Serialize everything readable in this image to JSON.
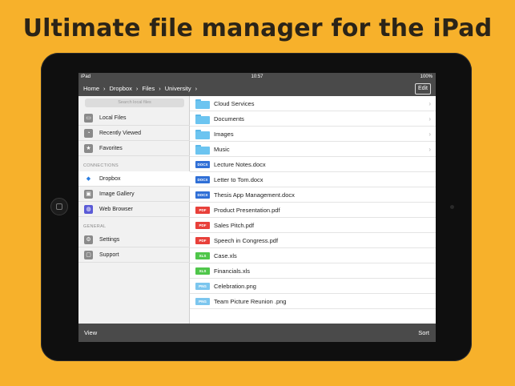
{
  "headline": "Ultimate file manager for the iPad",
  "statusbar": {
    "device": "iPad",
    "wifi_icon": "wifi-icon",
    "time": "10:57",
    "battery": "100%"
  },
  "navbar": {
    "breadcrumbs": [
      "Home",
      "Dropbox",
      "Files",
      "University"
    ],
    "edit_label": "Edit"
  },
  "sidebar": {
    "search_placeholder": "Search local files",
    "items": [
      {
        "label": "Local Files",
        "icon": "local-files-icon"
      },
      {
        "label": "Recently Viewed",
        "icon": "clock-icon"
      },
      {
        "label": "Favorites",
        "icon": "star-icon"
      }
    ],
    "connections_header": "CONNECTIONS",
    "connections": [
      {
        "label": "Dropbox",
        "icon": "dropbox-icon",
        "active": true
      },
      {
        "label": "Image Gallery",
        "icon": "image-gallery-icon"
      },
      {
        "label": "Web Browser",
        "icon": "globe-icon"
      }
    ],
    "general_header": "GENERAL",
    "general": [
      {
        "label": "Settings",
        "icon": "gear-icon"
      },
      {
        "label": "Support",
        "icon": "chat-icon"
      }
    ]
  },
  "files": [
    {
      "name": "Cloud Services",
      "kind": "folder"
    },
    {
      "name": "Documents",
      "kind": "folder"
    },
    {
      "name": "Images",
      "kind": "folder"
    },
    {
      "name": "Music",
      "kind": "folder"
    },
    {
      "name": "Lecture Notes.docx",
      "kind": "DOCX"
    },
    {
      "name": "Letter to Tom.docx",
      "kind": "DOCX"
    },
    {
      "name": "Thesis App Management.docx",
      "kind": "DOCX"
    },
    {
      "name": "Product Presentation.pdf",
      "kind": "PDF"
    },
    {
      "name": "Sales Pitch.pdf",
      "kind": "PDF"
    },
    {
      "name": "Speech in Congress.pdf",
      "kind": "PDF"
    },
    {
      "name": "Case.xls",
      "kind": "XLS"
    },
    {
      "name": "Financials.xls",
      "kind": "XLS"
    },
    {
      "name": "Celebration.png",
      "kind": "PNG"
    },
    {
      "name": "Team Picture Reunion .png",
      "kind": "PNG"
    }
  ],
  "badge_colors": {
    "DOCX": "#2f6fd6",
    "PDF": "#e8403a",
    "XLS": "#4fc64a",
    "PNG": "#7cc6ee",
    "folder": "#6cc4f0",
    "sidebar_icon": "#8a8a8a",
    "dropbox": "#2a7de1",
    "web": "#5a5ad6"
  },
  "toolbar": {
    "view_label": "View",
    "sort_label": "Sort"
  }
}
